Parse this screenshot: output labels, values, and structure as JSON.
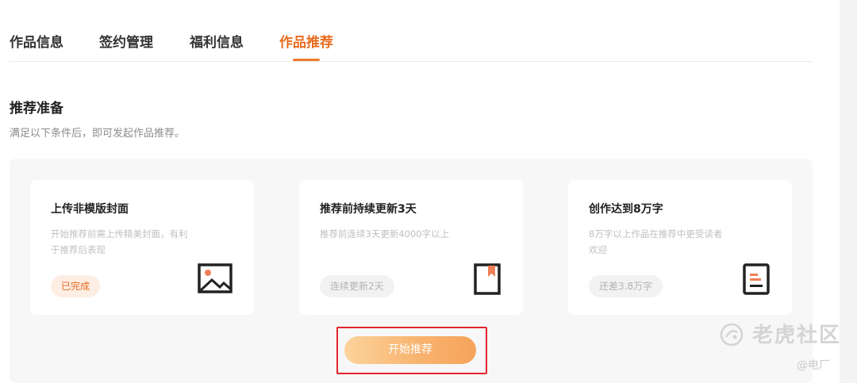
{
  "tabs": [
    {
      "label": "作品信息"
    },
    {
      "label": "签约管理"
    },
    {
      "label": "福利信息"
    },
    {
      "label": "作品推荐"
    }
  ],
  "section": {
    "title": "推荐准备",
    "description": "满足以下条件后，即可发起作品推荐。"
  },
  "cards": [
    {
      "title": "上传非模版封面",
      "description": "开始推荐前需上传精美封面，有利于推荐后表现",
      "badge": "已完成",
      "status": "done",
      "icon": "image-icon"
    },
    {
      "title": "推荐前持续更新3天",
      "description": "推荐前连续3天更新4000字以上",
      "badge": "连续更新2天",
      "status": "todo",
      "icon": "book-icon"
    },
    {
      "title": "创作达到8万字",
      "description": "8万字以上作品在推荐中更受读者欢迎",
      "badge": "还差3.8万字",
      "status": "todo",
      "icon": "document-icon"
    }
  ],
  "start_button": {
    "label": "开始推荐"
  },
  "watermark": {
    "text": "老虎社区",
    "sub": "@电厂"
  },
  "colors": {
    "accent": "#e86b1f",
    "button_start": "#fcd39c",
    "button_end": "#f6a35a",
    "highlight": "#e3262b"
  }
}
